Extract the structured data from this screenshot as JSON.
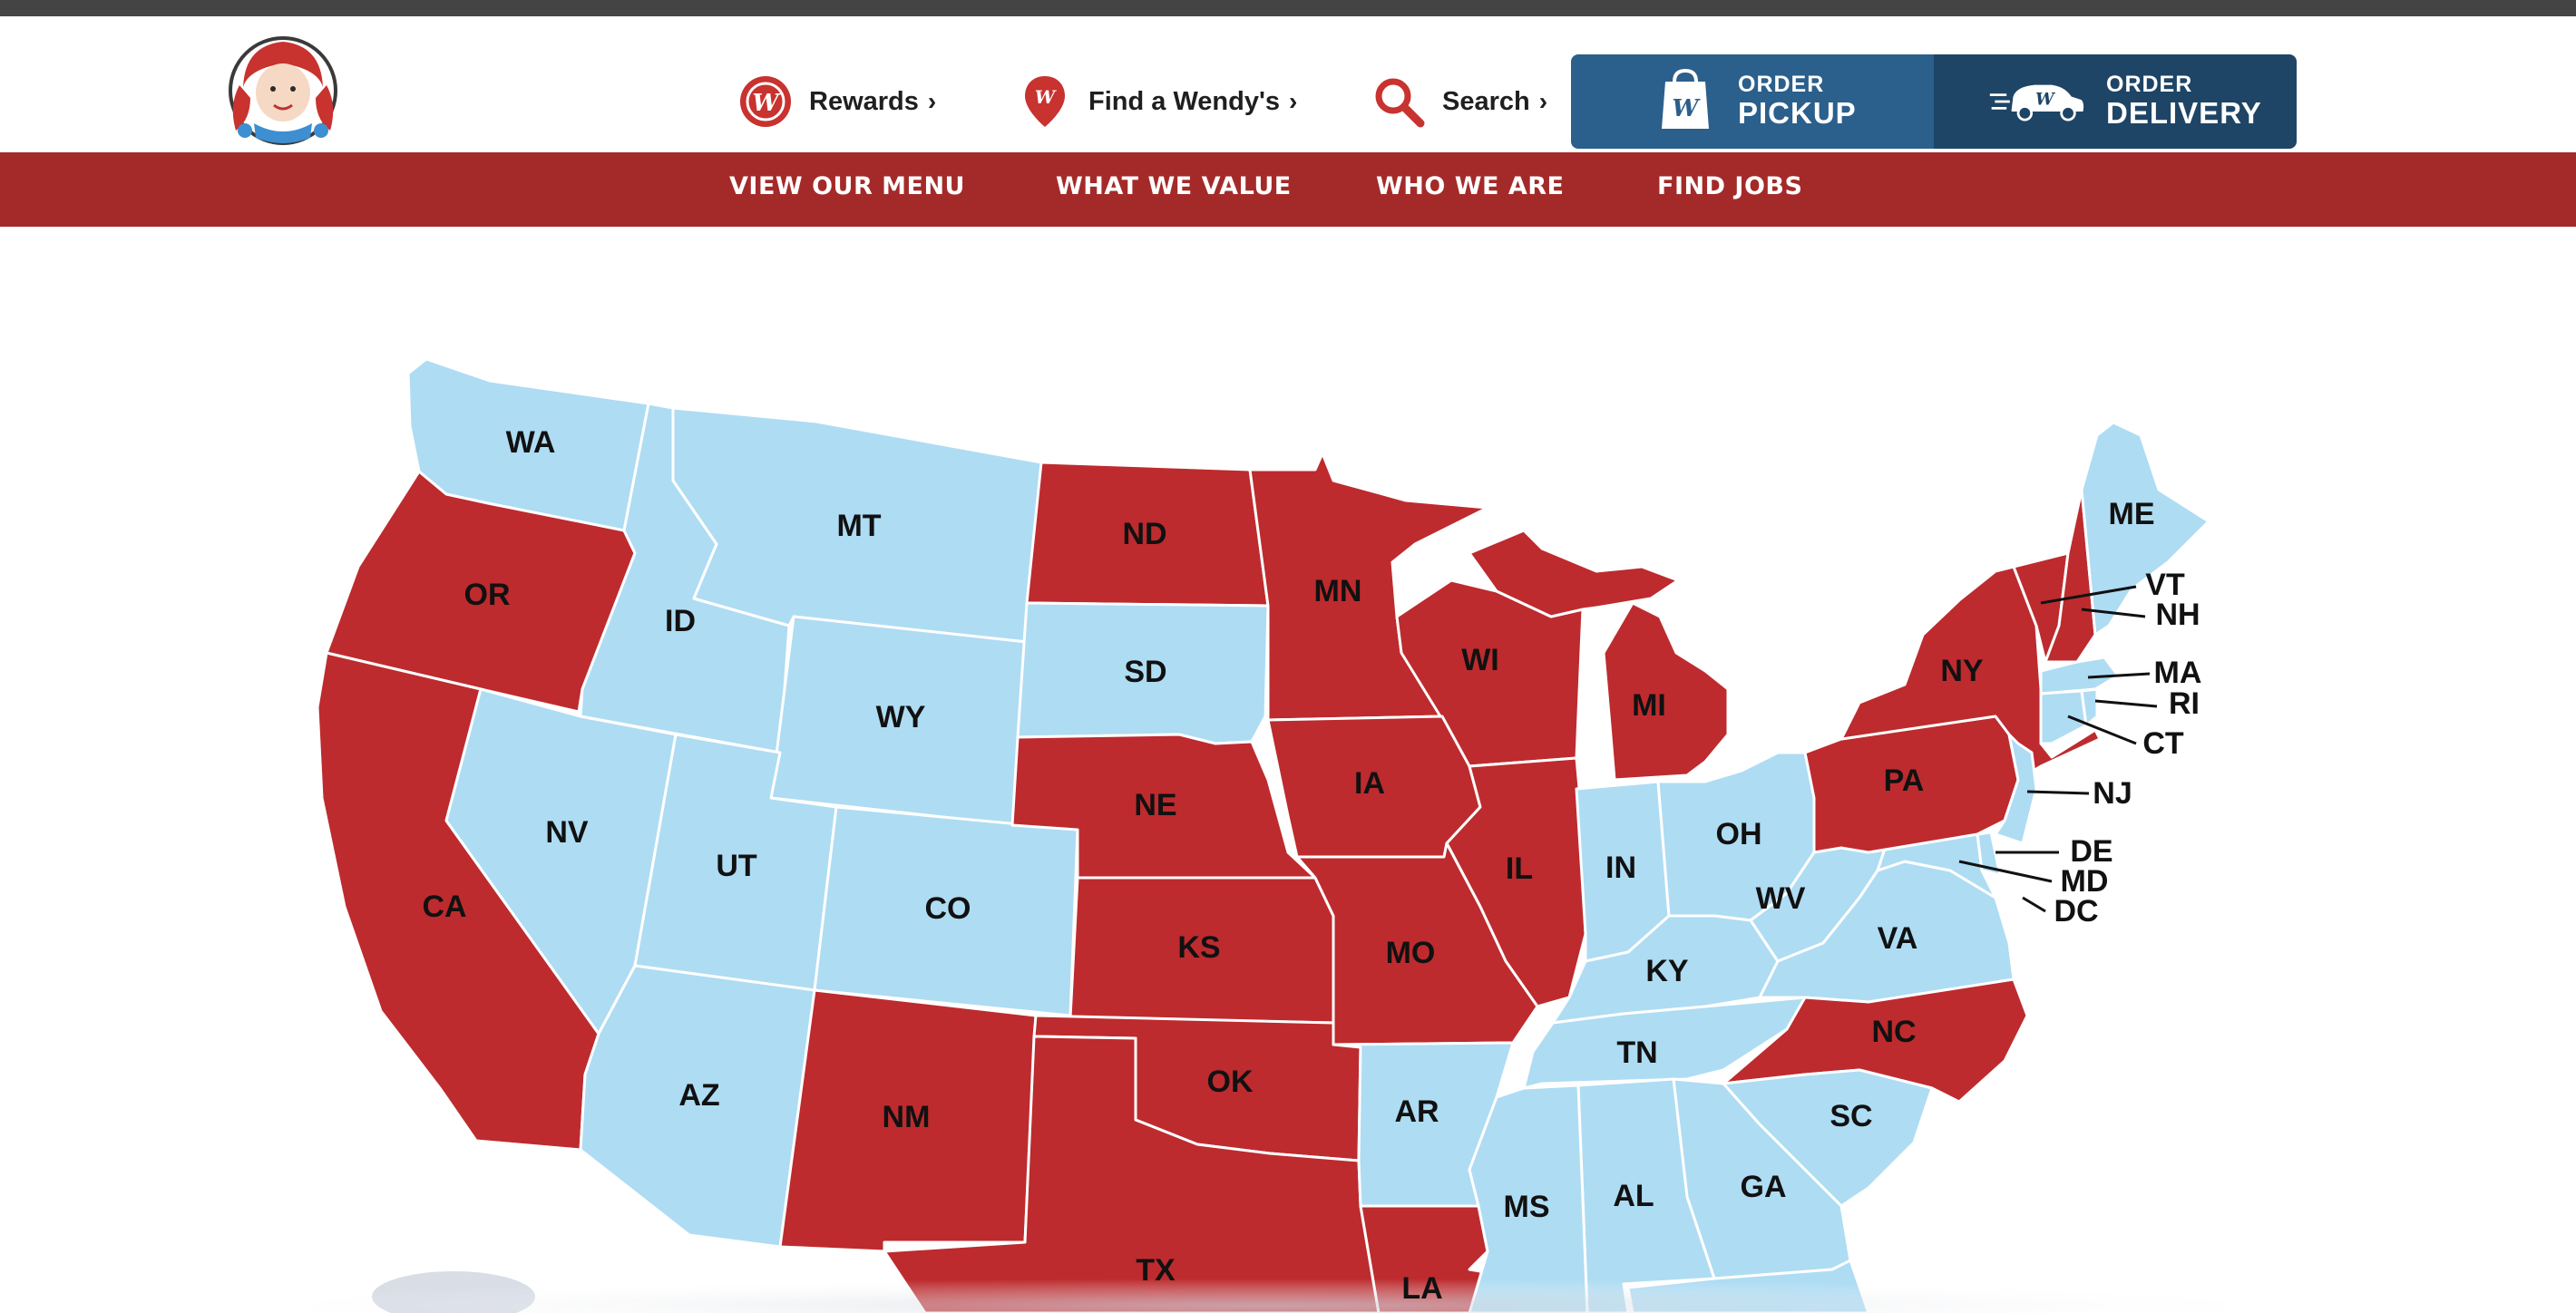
{
  "header": {
    "logo_icon": "wendys-logo",
    "utility_links": [
      {
        "label": "Rewards",
        "icon": "rewards-icon",
        "chevron": "›"
      },
      {
        "label": "Find a Wendy's",
        "icon": "location-pin-icon",
        "chevron": "›"
      },
      {
        "label": "Search",
        "icon": "search-icon",
        "chevron": "›"
      }
    ],
    "order_pickup": {
      "small": "ORDER",
      "big": "PICKUP",
      "icon": "bag-icon",
      "color": "#2b5f8c"
    },
    "order_delivery": {
      "small": "ORDER",
      "big": "DELIVERY",
      "icon": "delivery-car-icon",
      "color": "#1e4566"
    }
  },
  "nav": {
    "background": "#a42a29",
    "items": [
      "VIEW OUR MENU",
      "WHAT WE VALUE",
      "WHO WE ARE",
      "FIND JOBS"
    ]
  },
  "map": {
    "colors": {
      "red": "#bd2b2e",
      "blue": "#aedcf3",
      "border": "#ffffff"
    },
    "labels": {
      "WA": "WA",
      "OR": "OR",
      "CA": "CA",
      "ID": "ID",
      "NV": "NV",
      "MT": "MT",
      "WY": "WY",
      "UT": "UT",
      "AZ": "AZ",
      "CO": "CO",
      "NM": "NM",
      "ND": "ND",
      "SD": "SD",
      "NE": "NE",
      "KS": "KS",
      "OK": "OK",
      "TX": "TX",
      "MN": "MN",
      "IA": "IA",
      "MO": "MO",
      "AR": "AR",
      "LA": "LA",
      "WI": "WI",
      "IL": "IL",
      "MI": "MI",
      "IN": "IN",
      "OH": "OH",
      "KY": "KY",
      "TN": "TN",
      "MS": "MS",
      "AL": "AL",
      "GA": "GA",
      "SC": "SC",
      "NC": "NC",
      "VA": "VA",
      "WV": "WV",
      "PA": "PA",
      "NY": "NY",
      "ME": "ME",
      "VT": "VT",
      "NH": "NH",
      "MA": "MA",
      "RI": "RI",
      "CT": "CT",
      "NJ": "NJ",
      "DE": "DE",
      "MD": "MD",
      "DC": "DC"
    }
  }
}
